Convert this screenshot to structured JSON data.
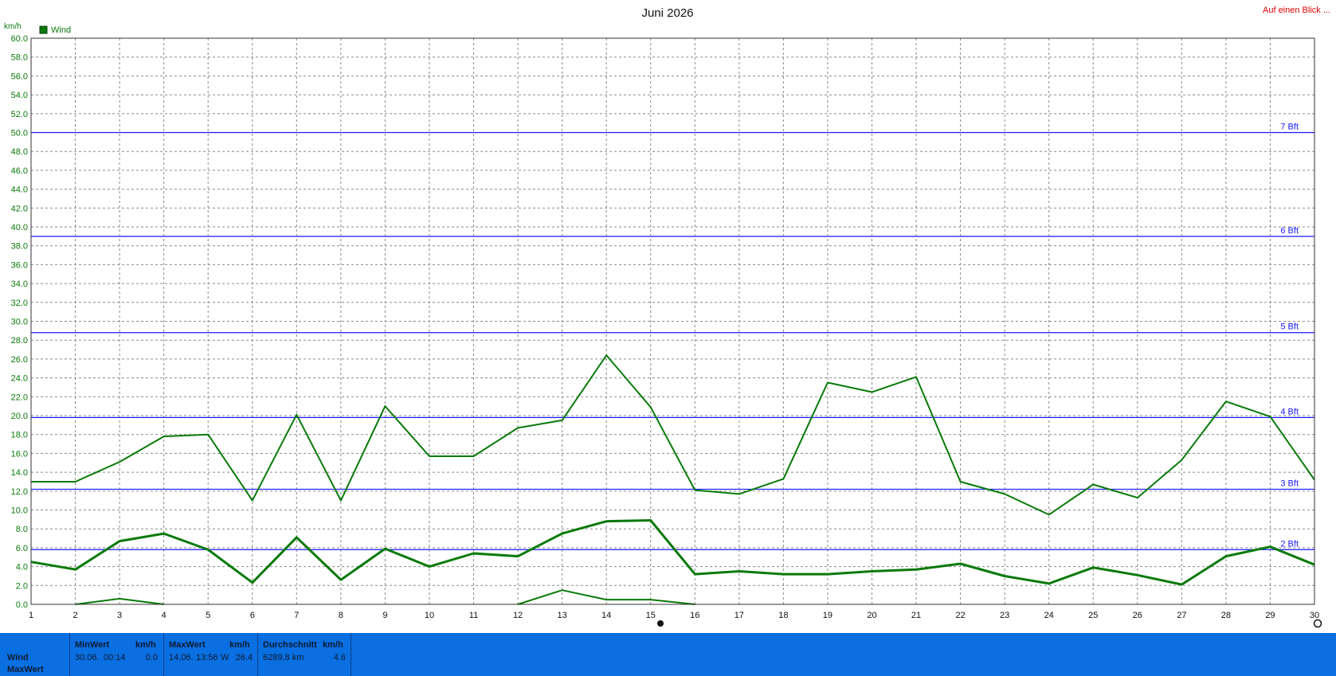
{
  "chart_data": {
    "type": "line",
    "title": "Juni 2026",
    "link_text": "Auf einen Blick ...",
    "ylabel": "km/h",
    "ylim": [
      0,
      60
    ],
    "yticks": [
      "0.0",
      "2.0",
      "4.0",
      "6.0",
      "8.0",
      "10.0",
      "12.0",
      "14.0",
      "16.0",
      "18.0",
      "20.0",
      "22.0",
      "24.0",
      "26.0",
      "28.0",
      "30.0",
      "32.0",
      "34.0",
      "36.0",
      "38.0",
      "40.0",
      "42.0",
      "44.0",
      "46.0",
      "48.0",
      "50.0",
      "52.0",
      "54.0",
      "56.0",
      "58.0",
      "60.0"
    ],
    "xlim": [
      1,
      30
    ],
    "x": [
      1,
      2,
      3,
      4,
      5,
      6,
      7,
      8,
      9,
      10,
      11,
      12,
      13,
      14,
      15,
      16,
      17,
      18,
      19,
      20,
      21,
      22,
      23,
      24,
      25,
      26,
      27,
      28,
      29,
      30
    ],
    "grid": true,
    "legend": {
      "position": "top-left",
      "label": "Wind",
      "color": "#0a7a0a"
    },
    "series": [
      {
        "name": "Wind",
        "role": "max",
        "color": "#0a7a0a",
        "width": 2,
        "values": [
          13.0,
          13.0,
          15.1,
          17.8,
          18.0,
          11.0,
          20.1,
          11.0,
          21.0,
          15.7,
          15.7,
          18.7,
          19.5,
          26.4,
          20.9,
          12.1,
          11.7,
          13.3,
          23.5,
          22.5,
          24.1,
          13.0,
          11.7,
          9.5,
          12.7,
          11.3,
          15.3,
          21.5,
          19.9,
          13.2
        ]
      },
      {
        "name": "Wind",
        "role": "avg",
        "color": "#0a7a0a",
        "width": 3,
        "values": [
          4.5,
          3.7,
          6.7,
          7.5,
          5.8,
          2.3,
          7.1,
          2.6,
          5.9,
          4.0,
          5.4,
          5.1,
          7.5,
          8.8,
          8.9,
          3.2,
          3.5,
          3.2,
          3.2,
          3.5,
          3.7,
          4.3,
          3.0,
          2.2,
          3.9,
          3.1,
          2.1,
          5.1,
          6.1,
          4.2
        ]
      },
      {
        "name": "Wind",
        "role": "min",
        "color": "#0a7a0a",
        "width": 2,
        "values": [
          null,
          0.0,
          0.6,
          0.0,
          null,
          null,
          null,
          null,
          null,
          null,
          null,
          0.0,
          1.5,
          0.5,
          0.5,
          0.0,
          null,
          null,
          null,
          null,
          null,
          null,
          null,
          null,
          null,
          null,
          null,
          null,
          null,
          null
        ]
      }
    ],
    "reference_lines": [
      {
        "label": "2 Bft",
        "value": 5.8
      },
      {
        "label": "3 Bft",
        "value": 12.2
      },
      {
        "label": "4 Bft",
        "value": 19.8
      },
      {
        "label": "5 Bft",
        "value": 28.8
      },
      {
        "label": "6 Bft",
        "value": 39.0
      },
      {
        "label": "7 Bft",
        "value": 50.0
      }
    ],
    "reference_color": "#1a1aff"
  },
  "stats": {
    "row1_label": "Wind",
    "row2_label": "MaxWert",
    "min": {
      "header": "MinWert",
      "unit": "km/h",
      "date": "30.06.",
      "time": "00:14",
      "value": "0.0"
    },
    "max": {
      "header": "MaxWert",
      "unit": "km/h",
      "date": "14.06.",
      "time": "13:56",
      "dir": "W",
      "value": "26.4"
    },
    "avg": {
      "header": "Durchschnitt",
      "unit": "km/h",
      "distance": "6289.8 km",
      "value": "4.6"
    }
  }
}
